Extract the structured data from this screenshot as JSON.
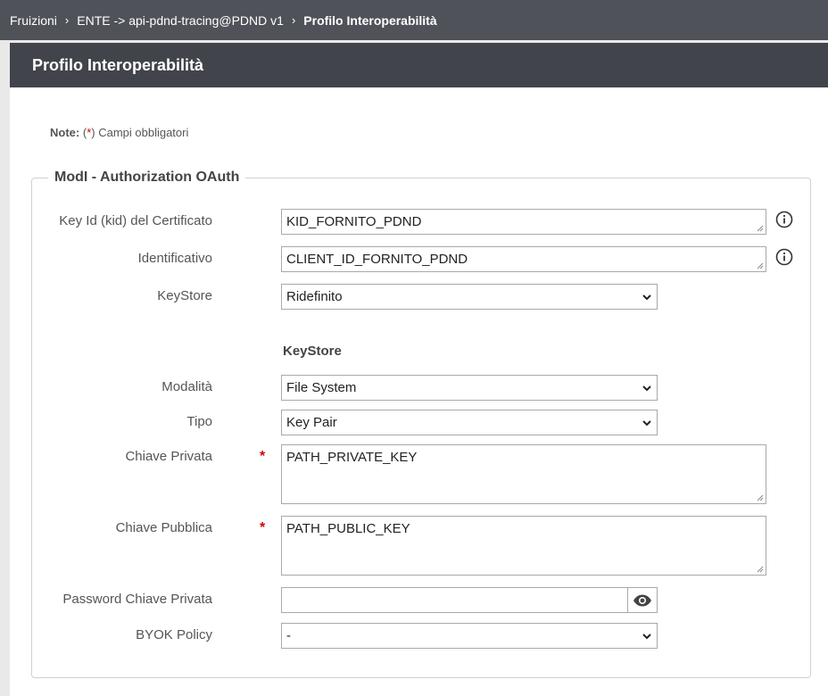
{
  "breadcrumb": {
    "items": [
      "Fruizioni",
      "ENTE -> api-pdnd-tracing@PDND v1"
    ],
    "current": "Profilo Interoperabilità"
  },
  "title": "Profilo Interoperabilità",
  "note": {
    "label": "Note:",
    "open": "(",
    "star": "*",
    "close": ")",
    "text": " Campi obbligatori"
  },
  "fieldset": {
    "legend": "ModI - Authorization OAuth",
    "fields": {
      "kid": {
        "label": "Key Id (kid) del Certificato",
        "value": "KID_FORNITO_PDND"
      },
      "identificativo": {
        "label": "Identificativo",
        "value": "CLIENT_ID_FORNITO_PDND"
      },
      "keystore": {
        "label": "KeyStore",
        "value": "Ridefinito"
      },
      "section": "KeyStore",
      "modalita": {
        "label": "Modalità",
        "value": "File System"
      },
      "tipo": {
        "label": "Tipo",
        "value": "Key Pair"
      },
      "chiave_privata": {
        "label": "Chiave Privata",
        "star": "*",
        "value": "PATH_PRIVATE_KEY"
      },
      "chiave_pubblica": {
        "label": "Chiave Pubblica",
        "star": "*",
        "value": "PATH_PUBLIC_KEY"
      },
      "password": {
        "label": "Password Chiave Privata",
        "value": ""
      },
      "byok": {
        "label": "BYOK Policy",
        "value": "-"
      }
    }
  },
  "colors": {
    "breadcrumb_bg": "#505259",
    "title_bg": "#42444b",
    "required": "#d40000"
  }
}
